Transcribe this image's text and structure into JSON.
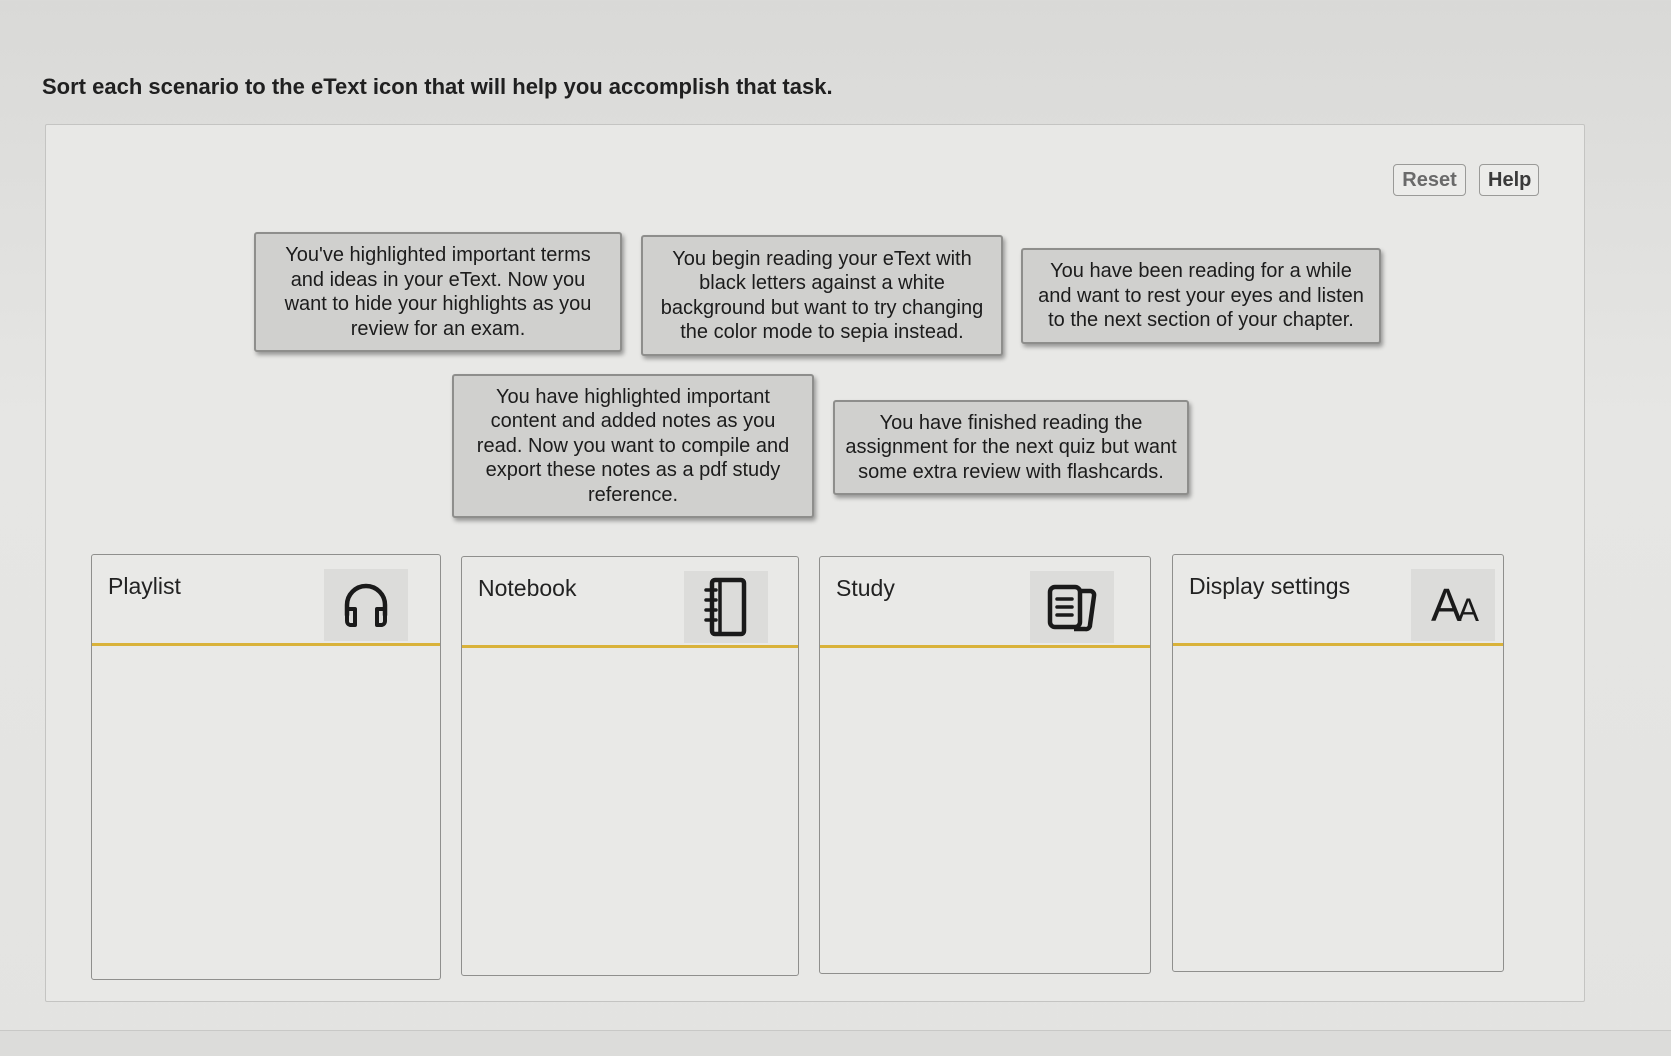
{
  "instruction": "Sort each scenario to the eText icon that will help you accomplish that task.",
  "controls": {
    "reset_label": "Reset",
    "help_label": "Help"
  },
  "cards": [
    {
      "lines": [
        "You've highlighted important terms",
        "and ideas in your eText. Now you",
        "want to hide your highlights as you",
        "review for an exam."
      ]
    },
    {
      "lines": [
        "You begin reading your eText with",
        "black letters against a white",
        "background but want to try changing",
        "the color mode to sepia instead."
      ]
    },
    {
      "lines": [
        "You have been reading for a while",
        "and want to rest your eyes and listen",
        "to the next section of your chapter."
      ]
    },
    {
      "lines": [
        "You have highlighted important",
        "content and added notes as you",
        "read. Now you want to compile and",
        "export these notes as a pdf study",
        "reference."
      ]
    },
    {
      "lines": [
        "You have finished reading the",
        "assignment for the next quiz but want",
        "some extra review with flashcards."
      ]
    }
  ],
  "bins": [
    {
      "label": "Playlist",
      "icon": "headphones-icon"
    },
    {
      "label": "Notebook",
      "icon": "notebook-icon"
    },
    {
      "label": "Study",
      "icon": "flashcards-icon"
    },
    {
      "label": "Display settings",
      "icon": "text-size-icon",
      "icon_text_large": "A",
      "icon_text_small": "A"
    }
  ],
  "colors": {
    "bin_header_underline": "#d9b23a",
    "card_background": "#d0d0ce",
    "panel_background": "#e8e8e6"
  }
}
